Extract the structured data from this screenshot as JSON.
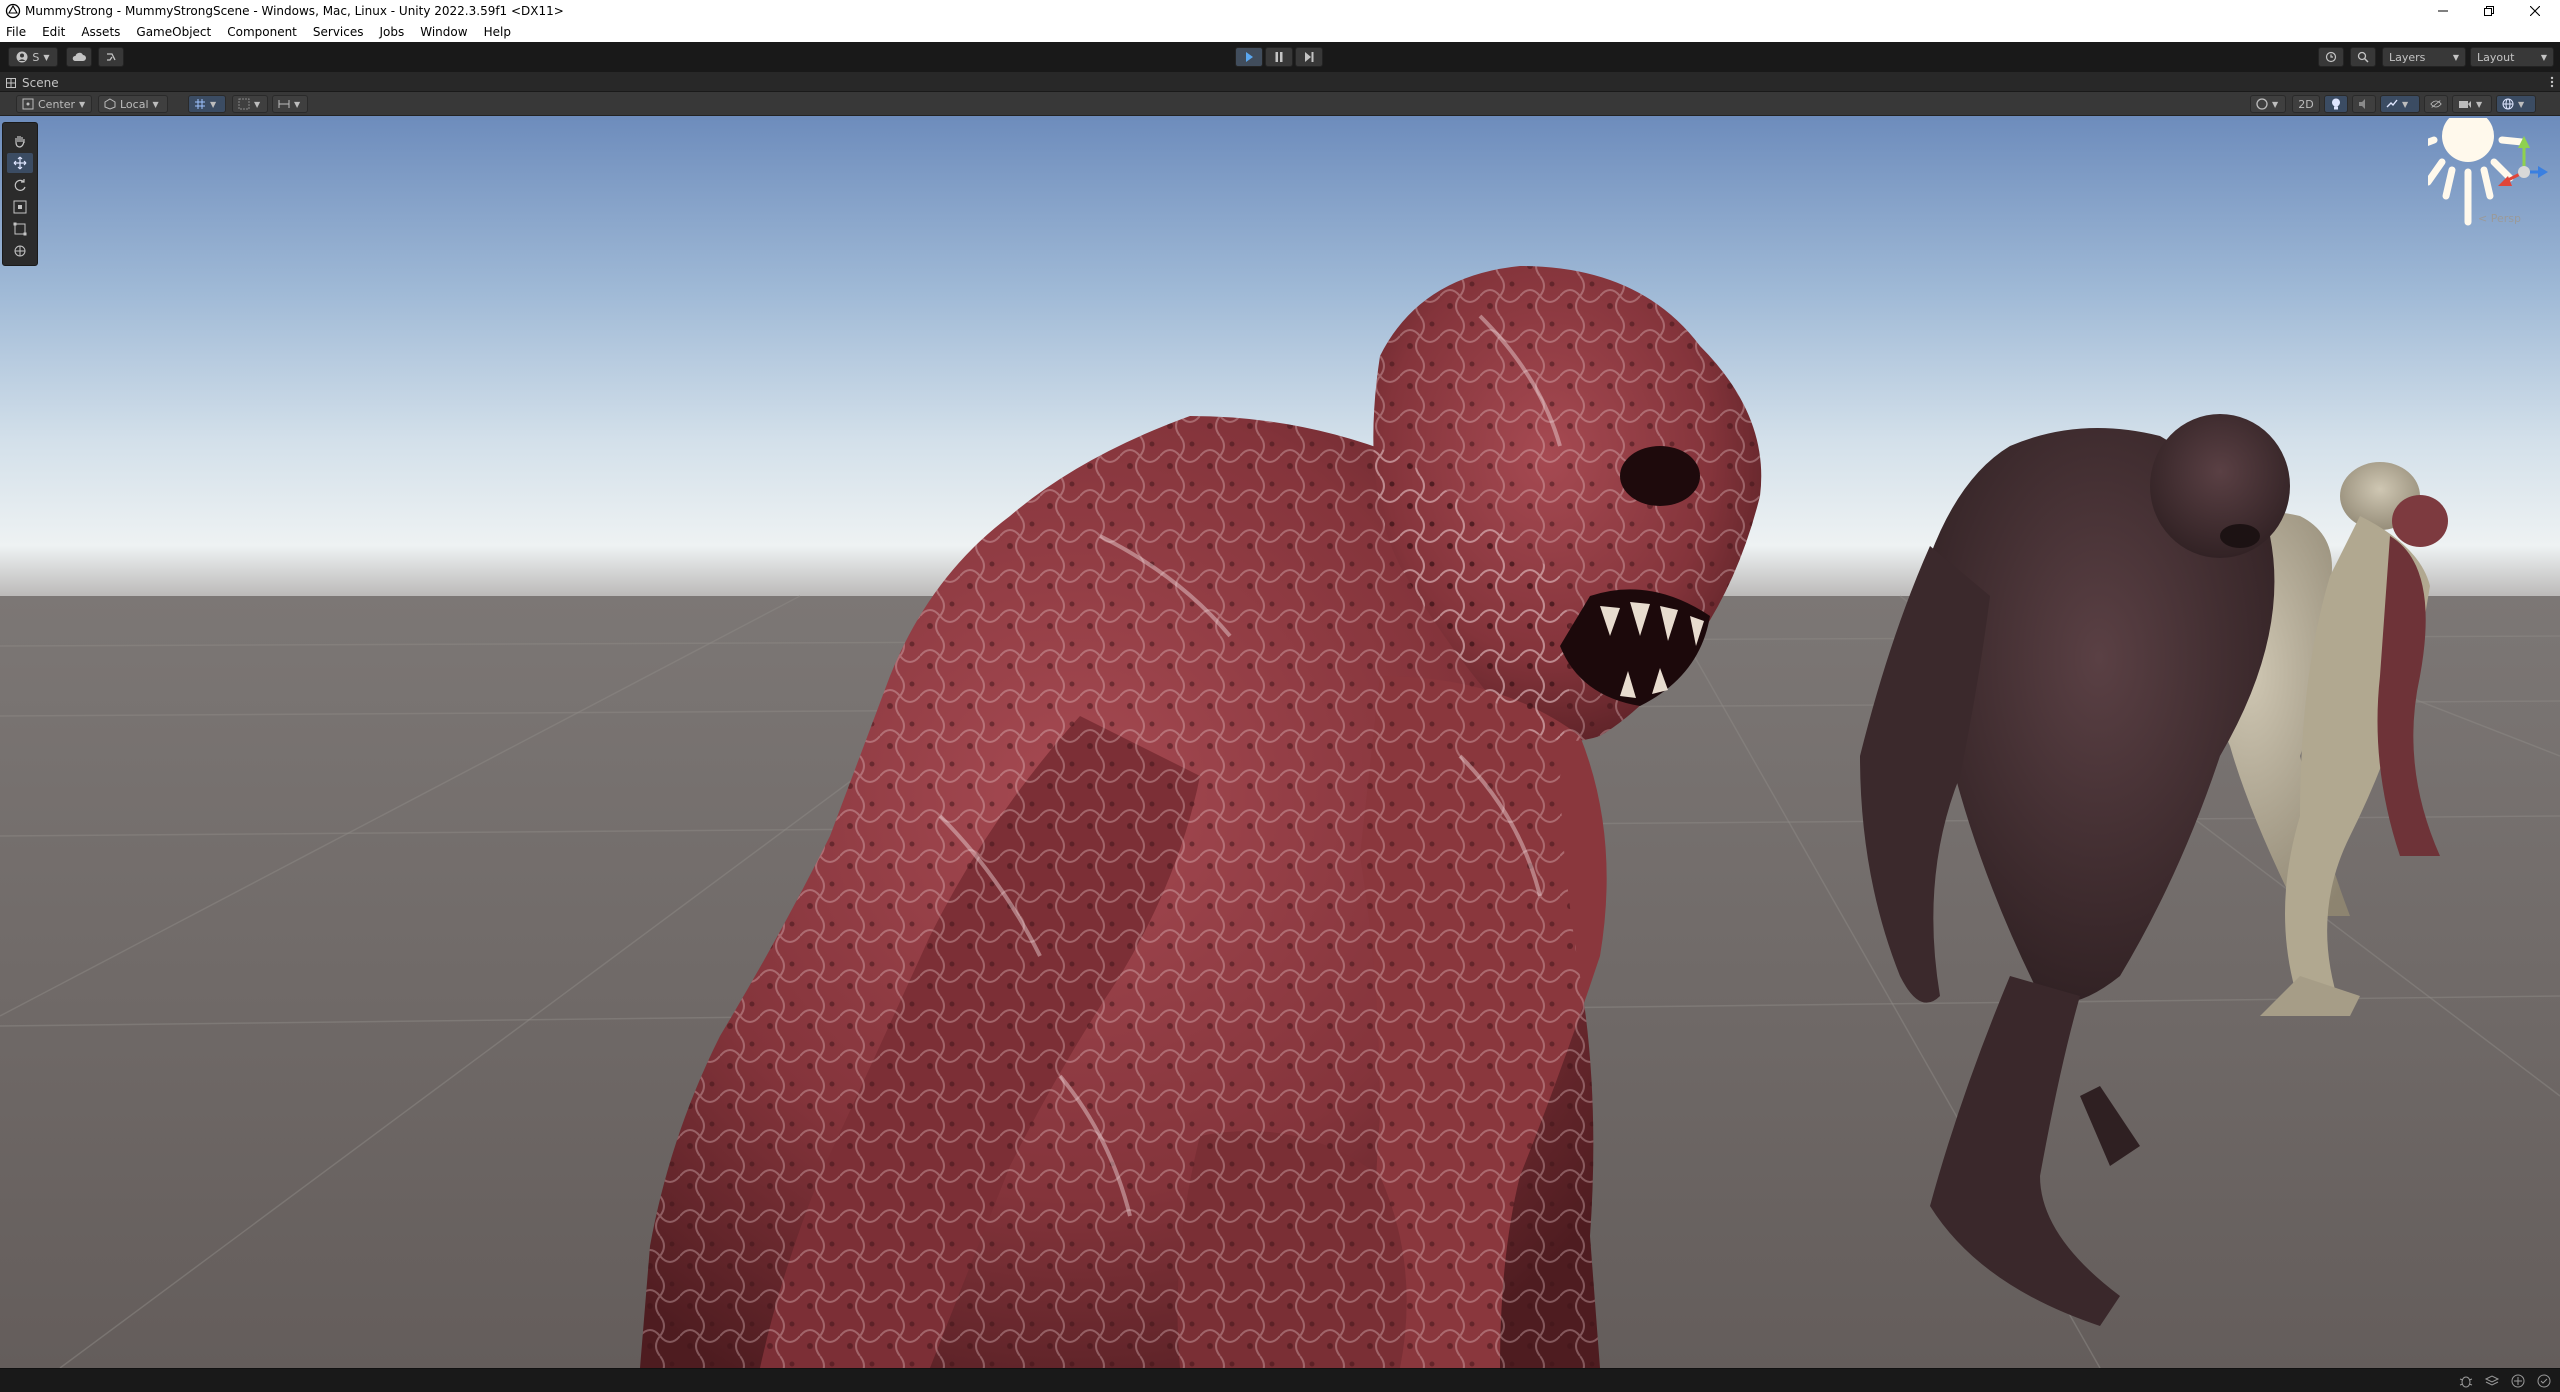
{
  "window": {
    "title": "MummyStrong - MummyStrongScene - Windows, Mac, Linux - Unity 2022.3.59f1 <DX11>",
    "controls": [
      "minimize-icon",
      "restore-icon",
      "close-icon"
    ]
  },
  "menubar": {
    "items": [
      "File",
      "Edit",
      "Assets",
      "GameObject",
      "Component",
      "Services",
      "Jobs",
      "Window",
      "Help"
    ]
  },
  "toolbar": {
    "account_label": "S",
    "layers_label": "Layers",
    "layout_label": "Layout",
    "play_state": "stopped"
  },
  "scene": {
    "tab_label": "Scene",
    "pivot_label": "Center",
    "space_label": "Local",
    "toggle_2d_label": "2D",
    "projection_label": "< Persp"
  },
  "colors": {
    "editor_dark": "#191919",
    "toolbar": "#383838",
    "sky_top": "#6f8fbd",
    "horizon": "#dfe8ee",
    "ground": "#6b6462",
    "creature_red": "#8f3a3f",
    "creature_dark": "#3f2a2c",
    "creature_bone": "#b5ad98",
    "accent_blue": "#3b4c63"
  }
}
